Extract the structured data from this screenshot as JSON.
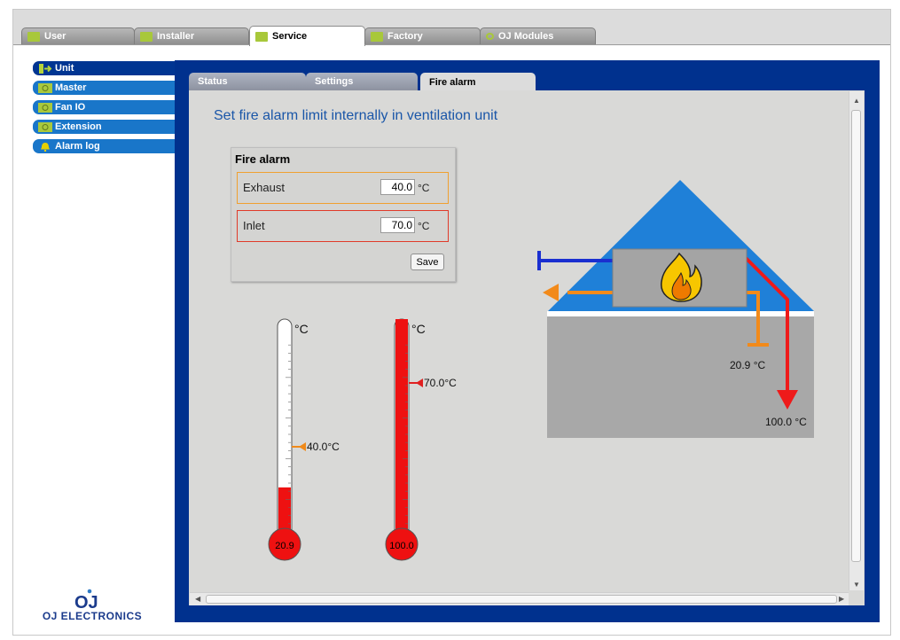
{
  "main_tabs": [
    {
      "label": "User",
      "active": false
    },
    {
      "label": "Installer",
      "active": false
    },
    {
      "label": "Service",
      "active": true
    },
    {
      "label": "Factory",
      "active": false
    },
    {
      "label": "OJ Modules",
      "active": false
    }
  ],
  "sidebar": {
    "items": [
      {
        "label": "Unit",
        "icon": "unit-icon",
        "active": true
      },
      {
        "label": "Master",
        "icon": "fan-icon"
      },
      {
        "label": "Fan IO",
        "icon": "fan-icon"
      },
      {
        "label": "Extension",
        "icon": "fan-icon"
      },
      {
        "label": "Alarm log",
        "icon": "bell-icon"
      }
    ]
  },
  "logo": {
    "mark": "OJ",
    "text": "OJ ELECTRONICS"
  },
  "sub_tabs": [
    {
      "label": "Status"
    },
    {
      "label": "Settings"
    },
    {
      "label": "Fire alarm",
      "active": true
    }
  ],
  "heading": "Set fire alarm limit internally in ventilation unit",
  "fire_alarm_box": {
    "title": "Fire alarm",
    "exhaust": {
      "label": "Exhaust",
      "value": "40.0",
      "unit": "°C",
      "color": "#f0a030"
    },
    "inlet": {
      "label": "Inlet",
      "value": "70.0",
      "unit": "°C",
      "color": "#e03a2a"
    },
    "save_label": "Save"
  },
  "thermometers": [
    {
      "unit": "°C",
      "reading": "20.9",
      "limit_label": "40.0°C",
      "level": 0.209,
      "limit": 0.4,
      "limit_color": "#f08a1a"
    },
    {
      "unit": "°C",
      "reading": "100.0",
      "limit_label": "70.0°C",
      "level": 1.0,
      "limit": 0.7,
      "limit_color": "#e02020"
    }
  ],
  "diagram": {
    "exhaust_temp": "20.9 °C",
    "inlet_temp": "100.0 °C"
  },
  "colors": {
    "brand_blue": "#00318e",
    "sidebar_blue": "#1976c9",
    "heading_blue": "#1a56a8",
    "roof_blue": "#1f80d8",
    "mercury_red": "#ee1111"
  }
}
